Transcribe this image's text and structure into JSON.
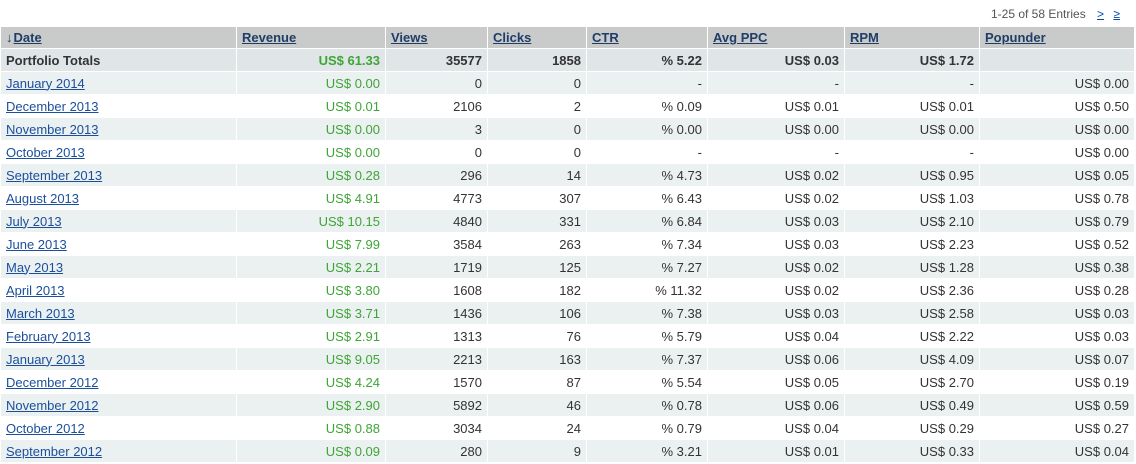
{
  "pager": {
    "summary": "1-25 of 58 Entries",
    "next_label": ">",
    "last_label": "≥"
  },
  "colors": {
    "header_bg": "#c9cbcb",
    "totals_bg": "#e0e6e8",
    "row_alt_bg": "#ebf0f1",
    "revenue_green": "#3fa535",
    "link_blue": "#1b4f9c"
  },
  "columns": {
    "sort_icon": "sort-descending-arrow-icon",
    "sort_glyph": "↓",
    "date": "Date",
    "revenue": "Revenue",
    "views": "Views",
    "clicks": "Clicks",
    "ctr": "CTR",
    "avg_ppc": "Avg PPC",
    "rpm": "RPM",
    "popunder": "Popunder"
  },
  "totals": {
    "label": "Portfolio Totals",
    "revenue": "US$ 61.33",
    "views": "35577",
    "clicks": "1858",
    "ctr": "% 5.22",
    "avg_ppc": "US$ 0.03",
    "rpm": "US$ 1.72",
    "popunder": ""
  },
  "rows": [
    {
      "date": "January 2014",
      "revenue": "US$ 0.00",
      "views": "0",
      "clicks": "0",
      "ctr": "-",
      "avg_ppc": "-",
      "rpm": "-",
      "popunder": "US$ 0.00"
    },
    {
      "date": "December 2013",
      "revenue": "US$ 0.01",
      "views": "2106",
      "clicks": "2",
      "ctr": "% 0.09",
      "avg_ppc": "US$ 0.01",
      "rpm": "US$ 0.01",
      "popunder": "US$ 0.50"
    },
    {
      "date": "November 2013",
      "revenue": "US$ 0.00",
      "views": "3",
      "clicks": "0",
      "ctr": "% 0.00",
      "avg_ppc": "US$ 0.00",
      "rpm": "US$ 0.00",
      "popunder": "US$ 0.00"
    },
    {
      "date": "October 2013",
      "revenue": "US$ 0.00",
      "views": "0",
      "clicks": "0",
      "ctr": "-",
      "avg_ppc": "-",
      "rpm": "-",
      "popunder": "US$ 0.00"
    },
    {
      "date": "September 2013",
      "revenue": "US$ 0.28",
      "views": "296",
      "clicks": "14",
      "ctr": "% 4.73",
      "avg_ppc": "US$ 0.02",
      "rpm": "US$ 0.95",
      "popunder": "US$ 0.05"
    },
    {
      "date": "August 2013",
      "revenue": "US$ 4.91",
      "views": "4773",
      "clicks": "307",
      "ctr": "% 6.43",
      "avg_ppc": "US$ 0.02",
      "rpm": "US$ 1.03",
      "popunder": "US$ 0.78"
    },
    {
      "date": "July 2013",
      "revenue": "US$ 10.15",
      "views": "4840",
      "clicks": "331",
      "ctr": "% 6.84",
      "avg_ppc": "US$ 0.03",
      "rpm": "US$ 2.10",
      "popunder": "US$ 0.79"
    },
    {
      "date": "June 2013",
      "revenue": "US$ 7.99",
      "views": "3584",
      "clicks": "263",
      "ctr": "% 7.34",
      "avg_ppc": "US$ 0.03",
      "rpm": "US$ 2.23",
      "popunder": "US$ 0.52"
    },
    {
      "date": "May 2013",
      "revenue": "US$ 2.21",
      "views": "1719",
      "clicks": "125",
      "ctr": "% 7.27",
      "avg_ppc": "US$ 0.02",
      "rpm": "US$ 1.28",
      "popunder": "US$ 0.38"
    },
    {
      "date": "April 2013",
      "revenue": "US$ 3.80",
      "views": "1608",
      "clicks": "182",
      "ctr": "% 11.32",
      "avg_ppc": "US$ 0.02",
      "rpm": "US$ 2.36",
      "popunder": "US$ 0.28"
    },
    {
      "date": "March 2013",
      "revenue": "US$ 3.71",
      "views": "1436",
      "clicks": "106",
      "ctr": "% 7.38",
      "avg_ppc": "US$ 0.03",
      "rpm": "US$ 2.58",
      "popunder": "US$ 0.03"
    },
    {
      "date": "February 2013",
      "revenue": "US$ 2.91",
      "views": "1313",
      "clicks": "76",
      "ctr": "% 5.79",
      "avg_ppc": "US$ 0.04",
      "rpm": "US$ 2.22",
      "popunder": "US$ 0.03"
    },
    {
      "date": "January 2013",
      "revenue": "US$ 9.05",
      "views": "2213",
      "clicks": "163",
      "ctr": "% 7.37",
      "avg_ppc": "US$ 0.06",
      "rpm": "US$ 4.09",
      "popunder": "US$ 0.07"
    },
    {
      "date": "December 2012",
      "revenue": "US$ 4.24",
      "views": "1570",
      "clicks": "87",
      "ctr": "% 5.54",
      "avg_ppc": "US$ 0.05",
      "rpm": "US$ 2.70",
      "popunder": "US$ 0.19"
    },
    {
      "date": "November 2012",
      "revenue": "US$ 2.90",
      "views": "5892",
      "clicks": "46",
      "ctr": "% 0.78",
      "avg_ppc": "US$ 0.06",
      "rpm": "US$ 0.49",
      "popunder": "US$ 0.59"
    },
    {
      "date": "October 2012",
      "revenue": "US$ 0.88",
      "views": "3034",
      "clicks": "24",
      "ctr": "% 0.79",
      "avg_ppc": "US$ 0.04",
      "rpm": "US$ 0.29",
      "popunder": "US$ 0.27"
    },
    {
      "date": "September 2012",
      "revenue": "US$ 0.09",
      "views": "280",
      "clicks": "9",
      "ctr": "% 3.21",
      "avg_ppc": "US$ 0.01",
      "rpm": "US$ 0.33",
      "popunder": "US$ 0.04"
    }
  ]
}
